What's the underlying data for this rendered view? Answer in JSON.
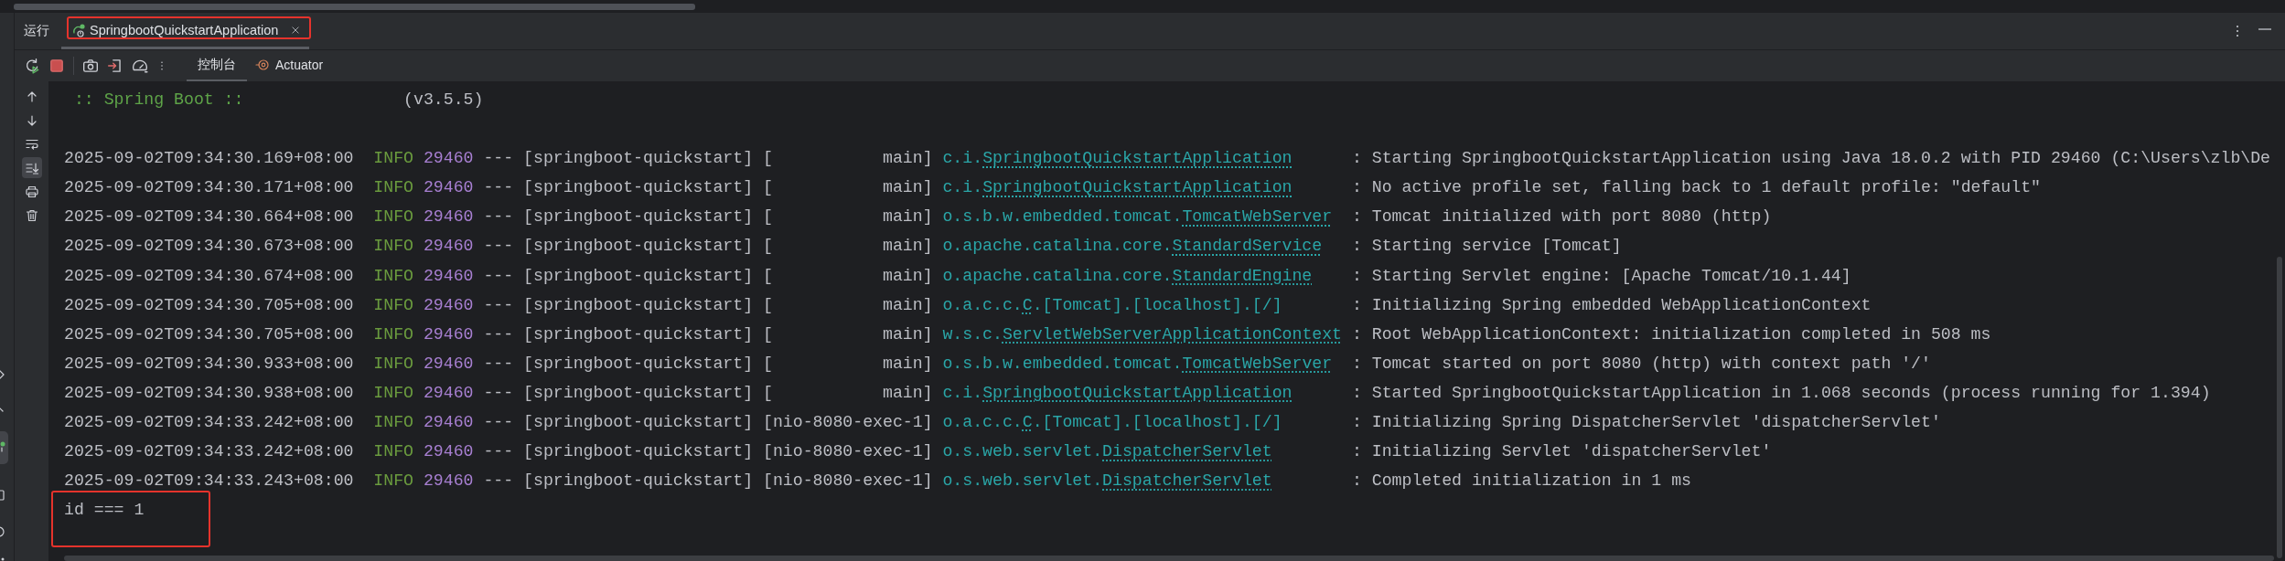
{
  "tool_window": {
    "title": "运行",
    "tabs": [
      {
        "label": "SpringbootQuickstartApplication",
        "selected": true,
        "highlighted": true
      }
    ]
  },
  "toolbar": {
    "tabs": [
      {
        "label": "控制台",
        "selected": true
      },
      {
        "label": "Actuator",
        "selected": false
      }
    ]
  },
  "side_actions": [
    {
      "kind": "scroll-up",
      "on": false
    },
    {
      "kind": "scroll-down",
      "on": false
    },
    {
      "kind": "soft-wrap",
      "on": false
    },
    {
      "kind": "scroll-to-end",
      "on": true
    },
    {
      "kind": "print",
      "on": false
    },
    {
      "kind": "clear",
      "on": false
    }
  ],
  "console": {
    "banner": {
      "title": ":: Spring Boot ::",
      "version": "(v3.5.5)"
    },
    "rows": [
      {
        "timestamp": "2025-09-02T09:34:30.169+08:00",
        "level": "INFO",
        "pid": "29460",
        "separator": "---",
        "app": "[springboot-quickstart]",
        "thread": "[           main]",
        "logger": [
          {
            "text": "c.i.",
            "link": false
          },
          {
            "text": "SpringbootQuickstartApplication",
            "link": true
          }
        ],
        "colon": ":",
        "message": "Starting SpringbootQuickstartApplication using Java 18.0.2 with PID 29460 (C:\\Users\\zlb\\De"
      },
      {
        "timestamp": "2025-09-02T09:34:30.171+08:00",
        "level": "INFO",
        "pid": "29460",
        "separator": "---",
        "app": "[springboot-quickstart]",
        "thread": "[           main]",
        "logger": [
          {
            "text": "c.i.",
            "link": false
          },
          {
            "text": "SpringbootQuickstartApplication",
            "link": true
          }
        ],
        "colon": ":",
        "message": "No active profile set, falling back to 1 default profile: \"default\""
      },
      {
        "timestamp": "2025-09-02T09:34:30.664+08:00",
        "level": "INFO",
        "pid": "29460",
        "separator": "---",
        "app": "[springboot-quickstart]",
        "thread": "[           main]",
        "logger": [
          {
            "text": "o.s.b.w.embedded.tomcat.",
            "link": false
          },
          {
            "text": "TomcatWebServer",
            "link": true
          }
        ],
        "colon": ":",
        "message": "Tomcat initialized with port 8080 (http)"
      },
      {
        "timestamp": "2025-09-02T09:34:30.673+08:00",
        "level": "INFO",
        "pid": "29460",
        "separator": "---",
        "app": "[springboot-quickstart]",
        "thread": "[           main]",
        "logger": [
          {
            "text": "o.apache.catalina.core.",
            "link": false
          },
          {
            "text": "StandardService",
            "link": true
          }
        ],
        "colon": ":",
        "message": "Starting service [Tomcat]"
      },
      {
        "timestamp": "2025-09-02T09:34:30.674+08:00",
        "level": "INFO",
        "pid": "29460",
        "separator": "---",
        "app": "[springboot-quickstart]",
        "thread": "[           main]",
        "logger": [
          {
            "text": "o.apache.catalina.core.",
            "link": false
          },
          {
            "text": "StandardEngine",
            "link": true
          }
        ],
        "colon": ":",
        "message": "Starting Servlet engine: [Apache Tomcat/10.1.44]"
      },
      {
        "timestamp": "2025-09-02T09:34:30.705+08:00",
        "level": "INFO",
        "pid": "29460",
        "separator": "---",
        "app": "[springboot-quickstart]",
        "thread": "[           main]",
        "logger": [
          {
            "text": "o.a.c.c.",
            "link": false
          },
          {
            "text": "C",
            "link": true
          },
          {
            "text": ".[Tomcat].[localhost].[/]",
            "link": false
          }
        ],
        "colon": ":",
        "message": "Initializing Spring embedded WebApplicationContext"
      },
      {
        "timestamp": "2025-09-02T09:34:30.705+08:00",
        "level": "INFO",
        "pid": "29460",
        "separator": "---",
        "app": "[springboot-quickstart]",
        "thread": "[           main]",
        "logger": [
          {
            "text": "w.s.c.",
            "link": false
          },
          {
            "text": "ServletWebServerApplicationContext",
            "link": true
          }
        ],
        "colon": ":",
        "message": "Root WebApplicationContext: initialization completed in 508 ms"
      },
      {
        "timestamp": "2025-09-02T09:34:30.933+08:00",
        "level": "INFO",
        "pid": "29460",
        "separator": "---",
        "app": "[springboot-quickstart]",
        "thread": "[           main]",
        "logger": [
          {
            "text": "o.s.b.w.embedded.tomcat.",
            "link": false
          },
          {
            "text": "TomcatWebServer",
            "link": true
          }
        ],
        "colon": ":",
        "message": "Tomcat started on port 8080 (http) with context path '/'"
      },
      {
        "timestamp": "2025-09-02T09:34:30.938+08:00",
        "level": "INFO",
        "pid": "29460",
        "separator": "---",
        "app": "[springboot-quickstart]",
        "thread": "[           main]",
        "logger": [
          {
            "text": "c.i.",
            "link": false
          },
          {
            "text": "SpringbootQuickstartApplication",
            "link": true
          }
        ],
        "colon": ":",
        "message": "Started SpringbootQuickstartApplication in 1.068 seconds (process running for 1.394)"
      },
      {
        "timestamp": "2025-09-02T09:34:33.242+08:00",
        "level": "INFO",
        "pid": "29460",
        "separator": "---",
        "app": "[springboot-quickstart]",
        "thread": "[nio-8080-exec-1]",
        "logger": [
          {
            "text": "o.a.c.c.",
            "link": false
          },
          {
            "text": "C",
            "link": true
          },
          {
            "text": ".[Tomcat].[localhost].[/]",
            "link": false
          }
        ],
        "colon": ":",
        "message": "Initializing Spring DispatcherServlet 'dispatcherServlet'"
      },
      {
        "timestamp": "2025-09-02T09:34:33.242+08:00",
        "level": "INFO",
        "pid": "29460",
        "separator": "---",
        "app": "[springboot-quickstart]",
        "thread": "[nio-8080-exec-1]",
        "logger": [
          {
            "text": "o.s.web.servlet.",
            "link": false
          },
          {
            "text": "DispatcherServlet",
            "link": true
          }
        ],
        "colon": ":",
        "message": "Initializing Servlet 'dispatcherServlet'"
      },
      {
        "timestamp": "2025-09-02T09:34:33.243+08:00",
        "level": "INFO",
        "pid": "29460",
        "separator": "---",
        "app": "[springboot-quickstart]",
        "thread": "[nio-8080-exec-1]",
        "logger": [
          {
            "text": "o.s.web.servlet.",
            "link": false
          },
          {
            "text": "DispatcherServlet",
            "link": true
          }
        ],
        "colon": ":",
        "message": "Completed initialization in 1 ms"
      }
    ],
    "output": [
      {
        "text": "id === 1",
        "highlighted": true
      }
    ]
  }
}
